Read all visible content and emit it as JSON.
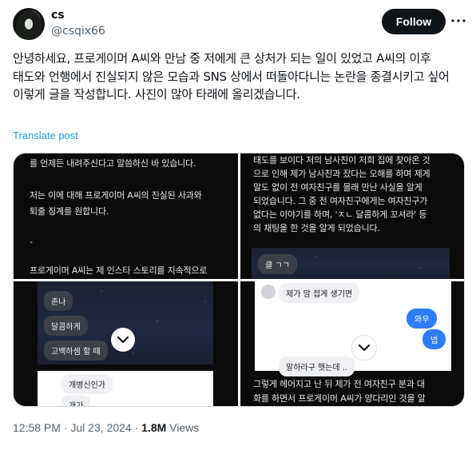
{
  "author": {
    "name": "cs",
    "handle": "@csqix66",
    "follow_label": "Follow"
  },
  "tweet": {
    "text": "안녕하세요, 프로게이머 A씨와 만남 중 저에게 큰 상처가 되는 일이 있었고 A씨의 이후 태도와 언행에서 진실되지 않은 모습과 SNS 상에서 떠돌아다니는 논란을 종결시키고 싶어 이렇게 글을 작성합니다. 사진이 많아 타래에 올리겠습니다.",
    "translate_label": "Translate post"
  },
  "media": {
    "img1": {
      "line1": "를 언제든 내려주신다고 말씀하신 바 있습니다.",
      "line2": "저는 이에 대해 프로게이머 A씨의 진실된 사과와",
      "line3": "퇴출 징계를 원합니다.",
      "line4": "-",
      "line5": "프로게이머 A씨는 제 인스타 스토리를 지속적으로"
    },
    "img2": {
      "line1": "태도를 보이다 저의 남사친이 저희 집에 찾아온 것",
      "line2": "으로 인해 제가 남사친과 잤다는 오해를 하며 제게",
      "line3": "말도 없이 전 여자친구를 몰래 만난 사실을 알게",
      "line4": "되었습니다. 그 중 전 여자친구에게는 여자친구가",
      "line5": "없다는 이야기를 하며, 'ㅈㄴ 달콤하게 꼬셔라' 등",
      "line6": "의 채팅을 한 것을 알게 되었습니다.",
      "bubble": "클 ㄱㄱ"
    },
    "img3": {
      "bubble1": "존나",
      "bubble2": "달콤하게",
      "bubble3": "고백하셈 할 때",
      "bubble4": "개병신인가",
      "bubble5": "개가"
    },
    "img4": {
      "bubble1": "제가 맘 접게 생기면",
      "bubble2": "와우",
      "bubble3": "넵",
      "bubble4": "말하라구 헷는데 ..",
      "line1": "그렇게 헤어지고 난 뒤 제가 전 여자친구 분과 대",
      "line2": "화를 하면서 프로게이머 A씨가 양다리인 것을 알"
    }
  },
  "meta": {
    "time": "12:58 PM",
    "separator": "·",
    "date": "Jul 23, 2024",
    "views_count": "1.8M",
    "views_label": "Views"
  },
  "colors": {
    "follow_bg": "#0f1419",
    "link": "#1d9bf0",
    "secondary_text": "#536471"
  }
}
